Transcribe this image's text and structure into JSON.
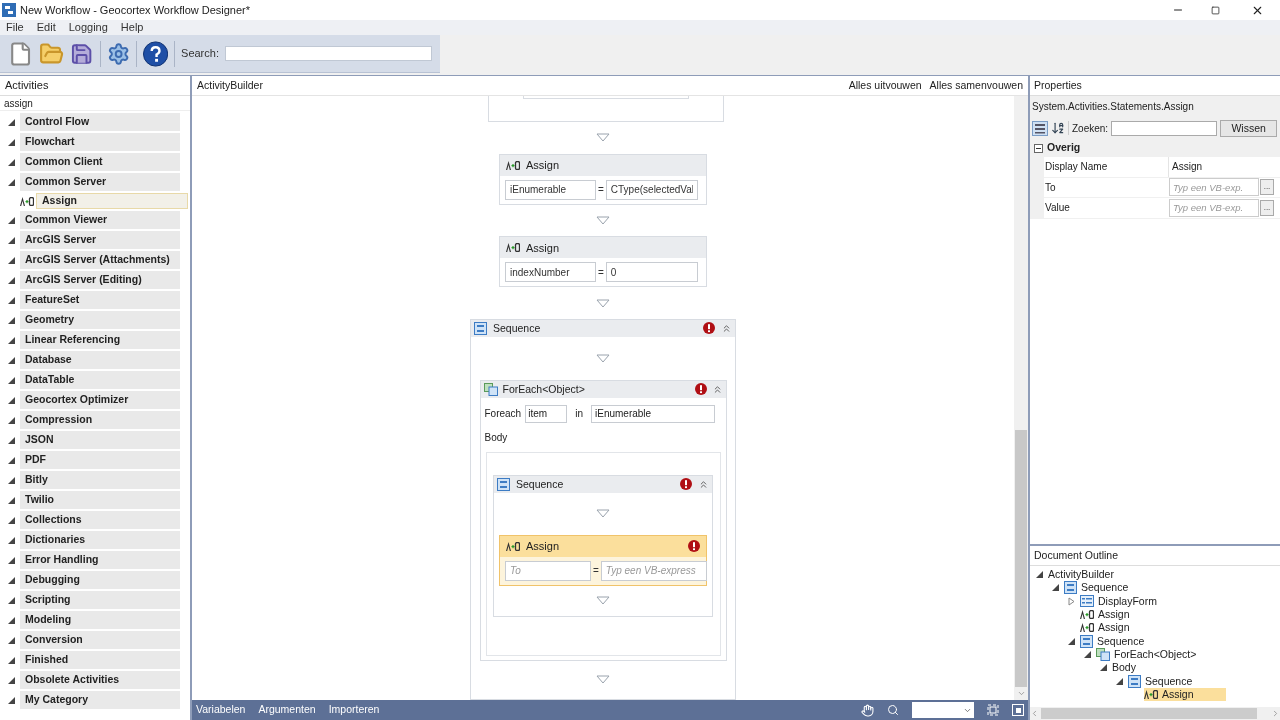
{
  "window": {
    "title": "New Workflow - Geocortex Workflow Designer*"
  },
  "menu": [
    "File",
    "Edit",
    "Logging",
    "Help"
  ],
  "toolbar": {
    "search_label": "Search:"
  },
  "activities": {
    "title": "Activities",
    "search_value": "assign",
    "items": [
      {
        "label": "Control Flow",
        "expanded": true
      },
      {
        "label": "Flowchart",
        "expanded": true
      },
      {
        "label": "Common Client",
        "expanded": true
      },
      {
        "label": "Common Server",
        "expanded": true,
        "children": [
          {
            "label": "Assign",
            "selected": true
          }
        ]
      },
      {
        "label": "Common Viewer",
        "expanded": true
      },
      {
        "label": "ArcGIS Server",
        "expanded": true
      },
      {
        "label": "ArcGIS Server (Attachments)",
        "expanded": true
      },
      {
        "label": "ArcGIS Server (Editing)",
        "expanded": true
      },
      {
        "label": "FeatureSet",
        "expanded": true
      },
      {
        "label": "Geometry",
        "expanded": true
      },
      {
        "label": "Linear Referencing",
        "expanded": true
      },
      {
        "label": "Database",
        "expanded": true
      },
      {
        "label": "DataTable",
        "expanded": true
      },
      {
        "label": "Geocortex Optimizer",
        "expanded": true
      },
      {
        "label": "Compression",
        "expanded": true
      },
      {
        "label": "JSON",
        "expanded": true
      },
      {
        "label": "PDF",
        "expanded": true
      },
      {
        "label": "Bitly",
        "expanded": true
      },
      {
        "label": "Twilio",
        "expanded": true
      },
      {
        "label": "Collections",
        "expanded": true
      },
      {
        "label": "Dictionaries",
        "expanded": true
      },
      {
        "label": "Error Handling",
        "expanded": true
      },
      {
        "label": "Debugging",
        "expanded": true
      },
      {
        "label": "Scripting",
        "expanded": true
      },
      {
        "label": "Modeling",
        "expanded": true
      },
      {
        "label": "Conversion",
        "expanded": true
      },
      {
        "label": "Finished",
        "expanded": true
      },
      {
        "label": "Obsolete Activities",
        "expanded": true
      },
      {
        "label": "My Category",
        "expanded": true
      }
    ]
  },
  "designer": {
    "title": "ActivityBuilder",
    "actions": [
      "Alles uitvouwen",
      "Alles samenvouwen"
    ],
    "top_assigns": [
      {
        "title": "Assign",
        "to": "iEnumerable",
        "operator": "=",
        "value": "CType(selectedVal"
      },
      {
        "title": "Assign",
        "to": "indexNumber",
        "operator": "=",
        "value": "0"
      }
    ],
    "sequence": {
      "title": "Sequence",
      "error": true,
      "foreach": {
        "title": "ForEach<Object>",
        "error": true,
        "label_foreach": "Foreach",
        "item": "item",
        "label_in": "in",
        "collection": "iEnumerable",
        "body_label": "Body",
        "sequence": {
          "title": "Sequence",
          "error": true,
          "assign": {
            "title": "Assign",
            "error": true,
            "selected": true,
            "to_placeholder": "To",
            "operator": "=",
            "value_placeholder": "Typ een VB-express"
          }
        }
      }
    },
    "bottom_tabs": [
      "Variabelen",
      "Argumenten",
      "Importeren"
    ]
  },
  "properties": {
    "title": "Properties",
    "type_name": "System.Activities.Statements.Assign",
    "search_label": "Zoeken:",
    "clear_button": "Wissen",
    "category": {
      "label": "Overig",
      "expanded": true
    },
    "rows": [
      {
        "kind": "text",
        "name": "Display Name",
        "value": "Assign"
      },
      {
        "kind": "expression",
        "name": "To",
        "placeholder": "Typ een VB-exp.",
        "button": "..."
      },
      {
        "kind": "expression",
        "name": "Value",
        "placeholder": "Typ een VB-exp.",
        "button": "..."
      }
    ]
  },
  "outline": {
    "title": "Document Outline",
    "nodes": [
      {
        "label": "ActivityBuilder",
        "expanded": true,
        "selected": false,
        "children": [
          {
            "label": "Sequence",
            "kind": "sequence",
            "expanded": true,
            "selected": false,
            "children": [
              {
                "label": "DisplayForm",
                "kind": "form",
                "expanded": false,
                "selected": false
              },
              {
                "label": "Assign",
                "kind": "assign",
                "selected": false
              },
              {
                "label": "Assign",
                "kind": "assign",
                "selected": false
              },
              {
                "label": "Sequence",
                "kind": "sequence",
                "expanded": true,
                "selected": false,
                "children": [
                  {
                    "label": "ForEach<Object>",
                    "kind": "foreach",
                    "expanded": true,
                    "selected": false,
                    "children": [
                      {
                        "label": "Body",
                        "expanded": true,
                        "selected": false,
                        "children": [
                          {
                            "label": "Sequence",
                            "kind": "sequence",
                            "expanded": true,
                            "selected": false,
                            "children": [
                              {
                                "label": "Assign",
                                "kind": "assign",
                                "selected": true
                              }
                            ]
                          }
                        ]
                      }
                    ]
                  }
                ]
              }
            ]
          }
        ]
      }
    ]
  }
}
